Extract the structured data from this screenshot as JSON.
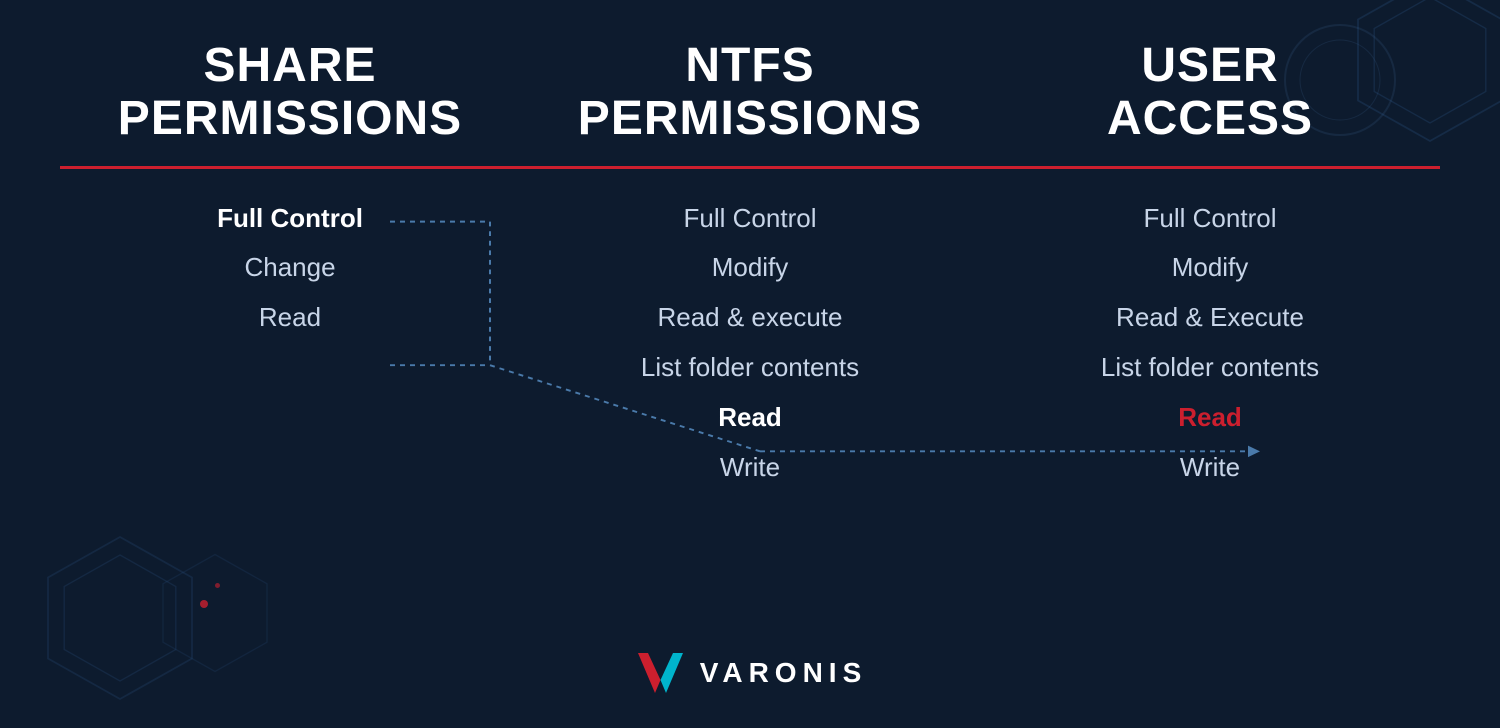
{
  "header": {
    "col1": {
      "line1": "SHARE",
      "line2": "PERMISSIONS"
    },
    "col2": {
      "line1": "NTFS",
      "line2": "PERMISSIONS"
    },
    "col3": {
      "line1": "USER",
      "line2": "ACCESS"
    }
  },
  "share_permissions": [
    {
      "label": "Full Control",
      "bold": true
    },
    {
      "label": "Change",
      "bold": false
    },
    {
      "label": "Read",
      "bold": false
    }
  ],
  "ntfs_permissions": [
    {
      "label": "Full Control",
      "bold": false
    },
    {
      "label": "Modify",
      "bold": false
    },
    {
      "label": "Read & execute",
      "bold": false
    },
    {
      "label": "List folder contents",
      "bold": false
    },
    {
      "label": "Read",
      "bold": true
    },
    {
      "label": "Write",
      "bold": false
    }
  ],
  "user_access": [
    {
      "label": "Full Control",
      "bold": false
    },
    {
      "label": "Modify",
      "bold": false
    },
    {
      "label": "Read & Execute",
      "bold": false
    },
    {
      "label": "List folder contents",
      "bold": false
    },
    {
      "label": "Read",
      "bold": true,
      "red": true
    },
    {
      "label": "Write",
      "bold": false
    }
  ],
  "logo": {
    "text": "VARONIS"
  }
}
